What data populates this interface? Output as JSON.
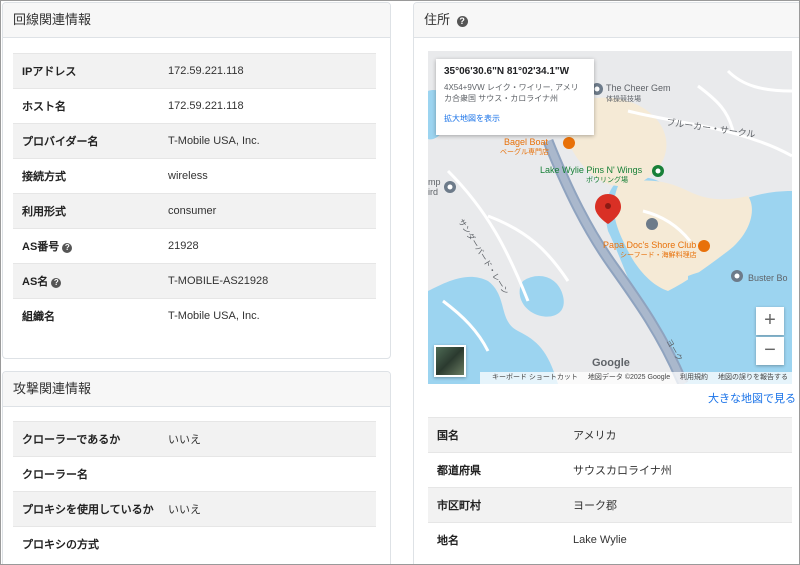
{
  "line_panel": {
    "title": "回線関連情報",
    "rows": [
      {
        "label": "IPアドレス",
        "value": "172.59.221.118",
        "help": false
      },
      {
        "label": "ホスト名",
        "value": "172.59.221.118",
        "help": false
      },
      {
        "label": "プロバイダー名",
        "value": "T-Mobile USA, Inc.",
        "help": false
      },
      {
        "label": "接続方式",
        "value": "wireless",
        "help": false
      },
      {
        "label": "利用形式",
        "value": "consumer",
        "help": false
      },
      {
        "label": "AS番号",
        "value": "21928",
        "help": true
      },
      {
        "label": "AS名",
        "value": "T-MOBILE-AS21928",
        "help": true
      },
      {
        "label": "組織名",
        "value": "T-Mobile USA, Inc.",
        "help": false
      }
    ]
  },
  "attack_panel": {
    "title": "攻撃関連情報",
    "rows": [
      {
        "label": "クローラーであるか",
        "value": "いいえ"
      },
      {
        "label": "クローラー名",
        "value": ""
      },
      {
        "label": "プロキシを使用しているか",
        "value": "いいえ"
      },
      {
        "label": "プロキシの方式",
        "value": ""
      }
    ]
  },
  "address_panel": {
    "title": "住所",
    "map": {
      "card_coords": "35°06'30.6\"N 81°02'34.1\"W",
      "card_address": "4X54+9VW レイク・ワイリー, アメリカ合衆国 サウス・カロライナ州",
      "card_link": "拡大地図を表示",
      "labels": {
        "cheer_gem": "The Cheer Gem",
        "cheer_gem_sub": "体操競技場",
        "bagel_boat": "Bagel Boat",
        "bagel_boat_sub": "ベーグル専門店",
        "pins_wings": "Lake Wylie Pins N' Wings",
        "pins_wings_sub": "ボウリング場",
        "papa_docs": "Papa Doc's Shore Club",
        "papa_docs_sub": "シーフード・海鮮料理店",
        "buster_bo": "Buster Bo",
        "bluecar": "ブルーカー・サークル",
        "thunder": "サンダーバード・レーン",
        "york": "ヨーク",
        "camp": "mp",
        "camp2": "ird"
      },
      "zoom_in": "+",
      "zoom_out": "−",
      "google": "Google",
      "attribution": {
        "shortcuts": "キーボード ショートカット",
        "data": "地図データ ©2025 Google",
        "terms": "利用規約",
        "report": "地図の誤りを報告する"
      }
    },
    "bigger_map_link": "大きな地図で見る",
    "rows": [
      {
        "label": "国名",
        "value": "アメリカ"
      },
      {
        "label": "都道府県",
        "value": "サウスカロライナ州"
      },
      {
        "label": "市区町村",
        "value": "ヨーク郡"
      },
      {
        "label": "地名",
        "value": "Lake Wylie"
      }
    ]
  },
  "colors": {
    "water": "#9cd4f0",
    "land": "#e9eaec",
    "poi_area": "#f5ead6",
    "road": "#8fa3bf",
    "link": "#1a73e8",
    "pin": "#d93025",
    "poi_orange": "#e8710a",
    "poi_green": "#188038",
    "poi_gray": "#6d7b8a"
  }
}
